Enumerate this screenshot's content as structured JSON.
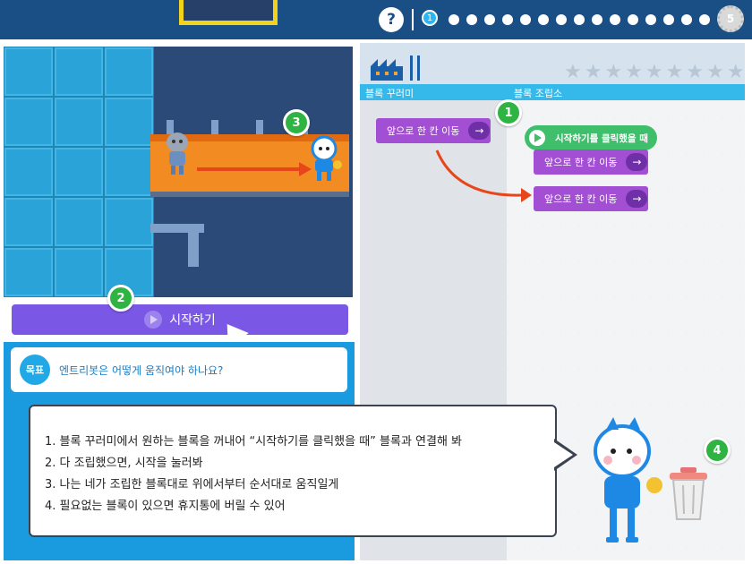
{
  "top_bar": {
    "help_label": "?",
    "current_step": "1",
    "total_steps_visible": 15,
    "reward_label": "5"
  },
  "stage": {
    "markers": [
      "1",
      "2",
      "3",
      "4"
    ]
  },
  "start_button": {
    "label": "시작하기"
  },
  "goal": {
    "badge": "목표",
    "text": "엔트리봇은 어떻게 움직여야 하나요?"
  },
  "right_panel": {
    "stars_count": 9,
    "palette_title": "블록 꾸러미",
    "assembly_title": "블록 조립소"
  },
  "blocks": {
    "palette_move": "앞으로 한 칸 이동",
    "start_block": "시작하기를 클릭했을 때",
    "assembled_move_1": "앞으로 한 칸 이동",
    "assembled_move_2": "앞으로 한 칸 이동"
  },
  "instructions": [
    "1. 블록 꾸러미에서 원하는 블록을 꺼내어 “시작하기를 클릭했을 때” 블록과 연결해 봐",
    "2. 다 조립했으면, 시작을 눌러봐",
    "3. 나는 네가 조립한 블록대로 위에서부터 순서대로 움직일게",
    "4. 필요없는 블록이 있으면 휴지통에 버릴 수 있어"
  ],
  "colors": {
    "top_bar": "#1a4f86",
    "start_button": "#7b57e5",
    "move_block": "#a24fd3",
    "start_block": "#3fbf6b",
    "marker": "#2fb342",
    "tabs_bar": "#35b8ea"
  }
}
